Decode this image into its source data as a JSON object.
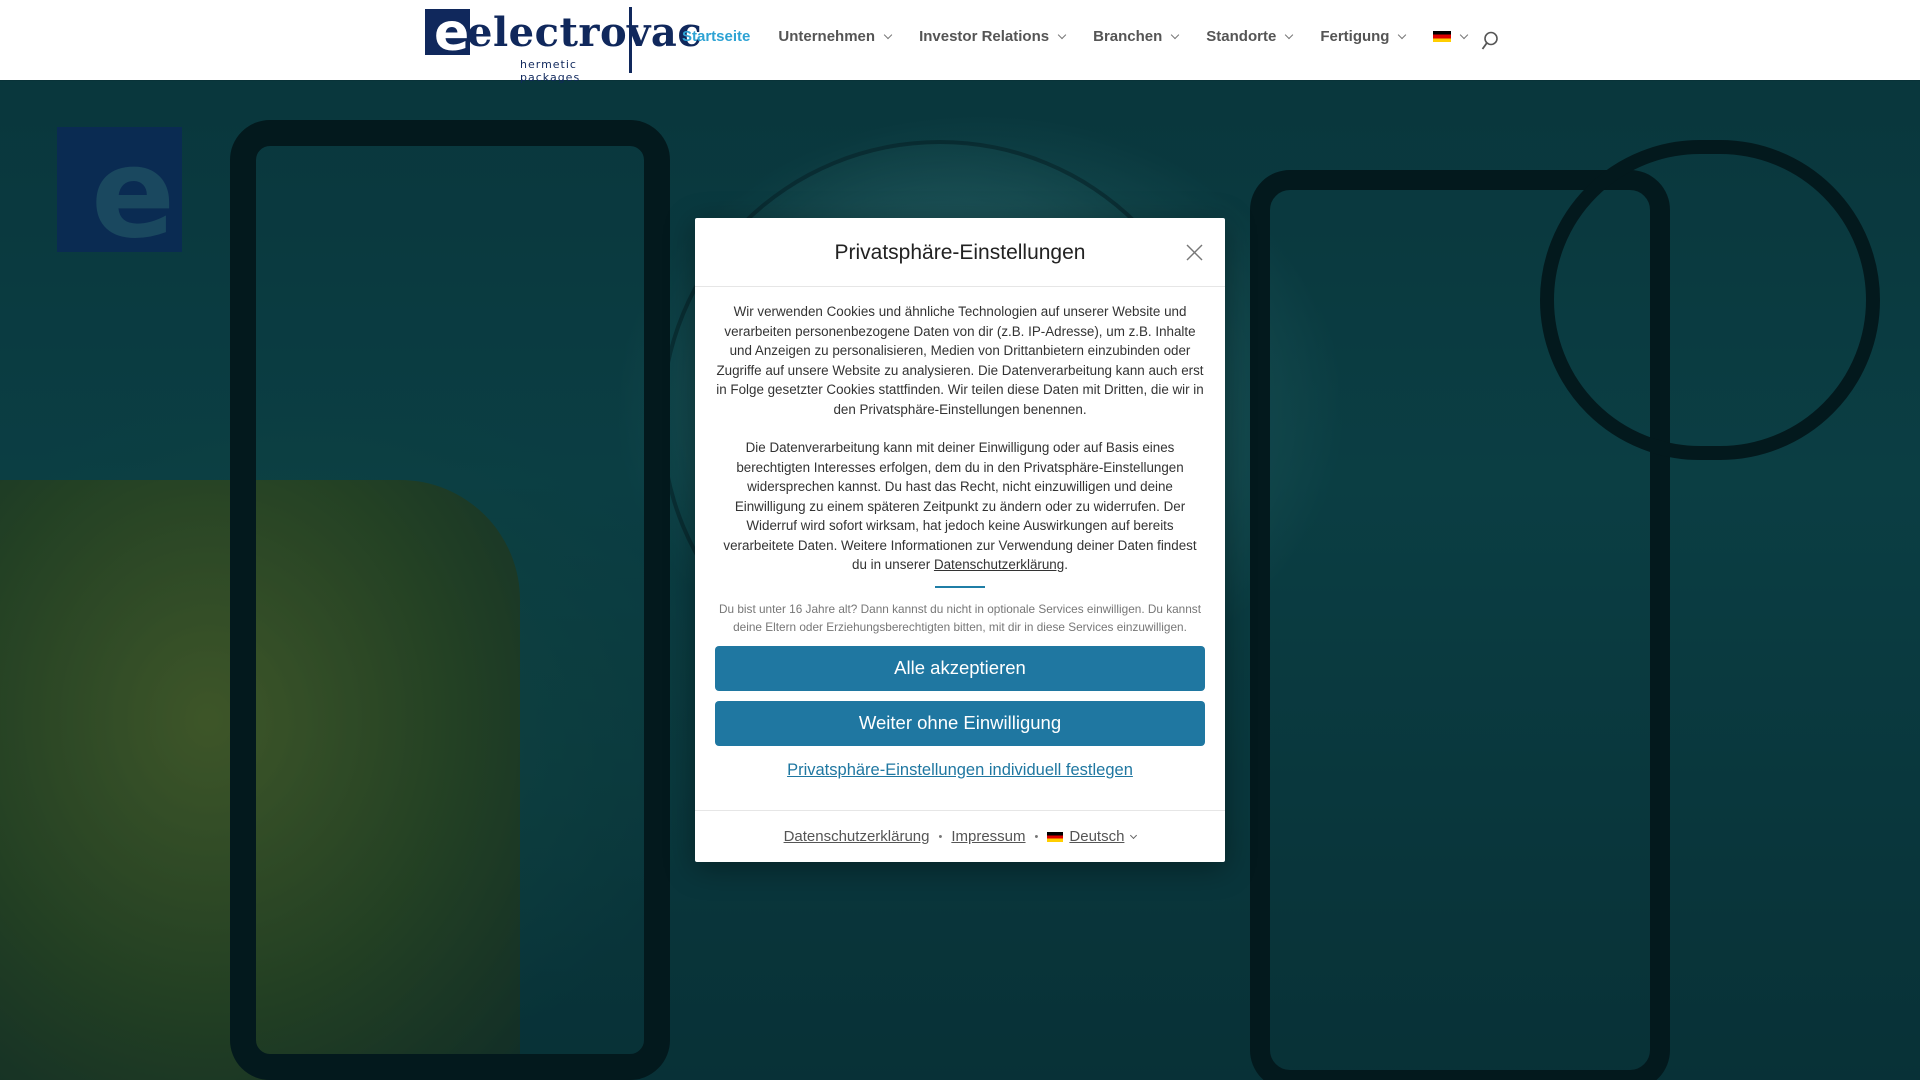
{
  "header": {
    "logo": {
      "wordmark": "electrovac",
      "tagline": "hermetic packages",
      "brand_color": "#10285c"
    },
    "nav": [
      {
        "label": "Startseite",
        "active": true,
        "has_dropdown": false
      },
      {
        "label": "Unternehmen",
        "active": false,
        "has_dropdown": true
      },
      {
        "label": "Investor Relations",
        "active": false,
        "has_dropdown": true
      },
      {
        "label": "Branchen",
        "active": false,
        "has_dropdown": true
      },
      {
        "label": "Standorte",
        "active": false,
        "has_dropdown": true
      },
      {
        "label": "Fertigung",
        "active": false,
        "has_dropdown": true
      }
    ],
    "language_icon": "flag-de-icon",
    "search_icon": "search-icon",
    "active_color": "#2ea3d4"
  },
  "modal": {
    "title": "Privatsphäre-Einstellungen",
    "paragraph1": "Wir verwenden Cookies und ähnliche Technologien auf unserer Website und verarbeiten personenbezogene Daten von dir (z.B. IP-Adresse), um z.B. Inhalte und Anzeigen zu personalisieren, Medien von Drittanbietern einzubinden oder Zugriffe auf unsere Website zu analysieren. Die Datenverarbeitung kann auch erst in Folge gesetzter Cookies stattfinden. Wir teilen diese Daten mit Dritten, die wir in den Privatsphäre-Einstellungen benennen.",
    "paragraph2_text": "Die Datenverarbeitung kann mit deiner Einwilligung oder auf Basis eines berechtigten Interesses erfolgen, dem du in den Privatsphäre-Einstellungen widersprechen kannst. Du hast das Recht, nicht einzuwilligen und deine Einwilligung zu einem späteren Zeitpunkt zu ändern oder zu widerrufen. Der Widerruf wird sofort wirksam, hat jedoch keine Auswirkungen auf bereits verarbeitete Daten. Weitere Informationen zur Verwendung deiner Daten findest du in unserer ",
    "paragraph2_link": "Datenschutzerklärung",
    "paragraph2_end": ".",
    "minor_notice": "Du bist unter 16 Jahre alt? Dann kannst du nicht in optionale Services einwilligen. Du kannst deine Eltern oder Erziehungsberechtigten bitten, mit dir in diese Services einzuwilligen.",
    "accept_all": "Alle akzeptieren",
    "continue_without": "Weiter ohne Einwilligung",
    "individual_settings": "Privatsphäre-Einstellungen individuell festlegen",
    "footer": {
      "privacy_link": "Datenschutzerklärung",
      "separator": "•",
      "imprint_link": "Impressum",
      "language": "Deutsch"
    },
    "button_color": "#1f77a1"
  }
}
